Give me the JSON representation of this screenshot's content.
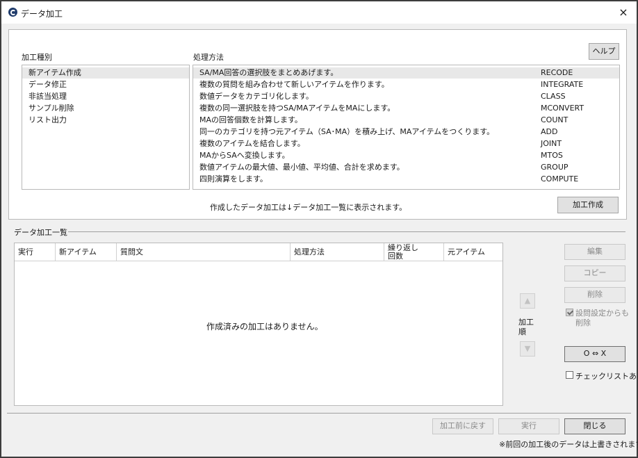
{
  "window": {
    "title": "データ加工",
    "close_icon": "×"
  },
  "processing": {
    "type_label": "加工種別",
    "method_label": "処理方法",
    "help_label": "ヘルプ",
    "types": [
      "新アイテム作成",
      "データ修正",
      "非該当処理",
      "サンプル削除",
      "リスト出力"
    ],
    "methods": [
      {
        "desc": "SA/MA回答の選択肢をまとめあげます。",
        "code": "RECODE"
      },
      {
        "desc": "複数の質問を組み合わせて新しいアイテムを作ります。",
        "code": "INTEGRATE"
      },
      {
        "desc": "数値データをカテゴリ化します。",
        "code": "CLASS"
      },
      {
        "desc": "複数の同一選択肢を持つSA/MAアイテムをMAにします。",
        "code": "MCONVERT"
      },
      {
        "desc": "MAの回答個数を計算します。",
        "code": "COUNT"
      },
      {
        "desc": "同一のカテゴリを持つ元アイテム（SA･MA）を積み上げ、MAアイテムをつくります。",
        "code": "ADD"
      },
      {
        "desc": "複数のアイテムを結合します。",
        "code": "JOINT"
      },
      {
        "desc": "MAからSAへ変換します。",
        "code": "MTOS"
      },
      {
        "desc": "数値アイテムの最大値、最小値、平均値、合計を求めます。",
        "code": "GROUP"
      },
      {
        "desc": "四則演算をします。",
        "code": "COMPUTE"
      }
    ],
    "note": "作成したデータ加工は↓データ加工一覧に表示されます。",
    "create_label": "加工作成"
  },
  "list": {
    "section_label": "データ加工一覧",
    "columns": [
      "実行",
      "新アイテム",
      "質問文",
      "処理方法",
      "繰り返し",
      "回数",
      "元アイテム"
    ],
    "empty_message": "作成済みの加工はありません。",
    "order_label_1": "加工",
    "order_label_2": "順",
    "edit_label": "編集",
    "copy_label": "コピー",
    "delete_label": "削除",
    "delete_from_settings_1": "設問設定からも",
    "delete_from_settings_2": "削除",
    "ox_label": "O ⇔ X",
    "checklist_label": "チェックリストあり"
  },
  "footer": {
    "revert_label": "加工前に戻す",
    "execute_label": "実行",
    "close_label": "閉じる",
    "note": "※前回の加工後のデータは上書きされます。"
  }
}
